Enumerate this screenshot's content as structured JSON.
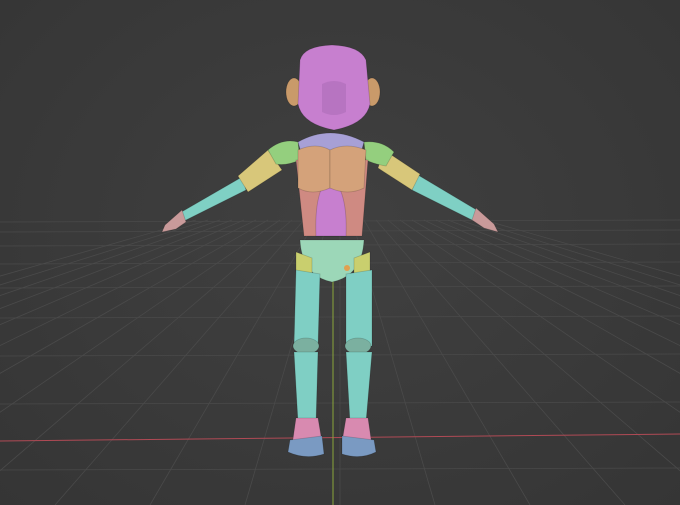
{
  "viewport": {
    "background": "#3a3a3a",
    "grid_color": "#4a4a4a",
    "x_axis_color": "#b04a55",
    "y_axis_color": "#8aa63a"
  },
  "model": {
    "object": "mannequin-figure",
    "colors": {
      "head": "#c77fcf",
      "ears": "#c99a6a",
      "neck_shoulders": "#a7a0d6",
      "chest": "#d4a27a",
      "torso_center": "#c77fcf",
      "torso_side": "#cf8a82",
      "shoulder_pads": "#94cf7e",
      "upper_arm": "#d8c77a",
      "forearm": "#7fd0c4",
      "hands": "#c99a9a",
      "pelvis": "#9cd7b8",
      "hip_side": "#c9cf6e",
      "legs": "#7fcfc4",
      "knees": "#7bb0a0",
      "feet_top": "#d88ab0",
      "soles": "#7a9ac2"
    }
  }
}
